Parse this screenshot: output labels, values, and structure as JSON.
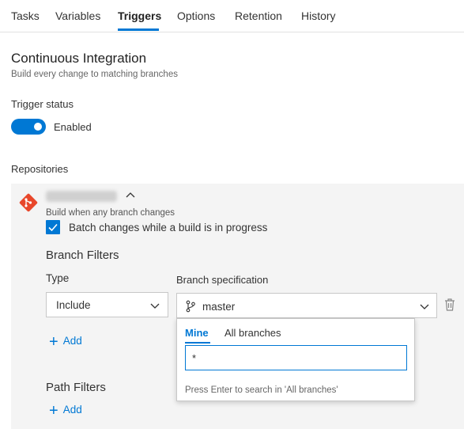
{
  "tabs": [
    {
      "label": "Tasks",
      "active": false
    },
    {
      "label": "Variables",
      "active": false
    },
    {
      "label": "Triggers",
      "active": true
    },
    {
      "label": "Options",
      "active": false
    },
    {
      "label": "Retention",
      "active": false
    },
    {
      "label": "History",
      "active": false
    }
  ],
  "ci": {
    "title": "Continuous Integration",
    "subtitle": "Build every change to matching branches"
  },
  "trigger_status": {
    "label": "Trigger status",
    "enabled": true,
    "state_label": "Enabled"
  },
  "repositories": {
    "label": "Repositories",
    "repo": {
      "icon": "git-icon",
      "name_obscured": true,
      "build_when": "Build when any branch changes",
      "batch_changes": {
        "checked": true,
        "label": "Batch changes while a build is in progress"
      }
    }
  },
  "branch_filters": {
    "label": "Branch Filters",
    "type_label": "Type",
    "spec_label": "Branch specification",
    "type_value": "Include",
    "branch_value": "master",
    "add_label": "Add"
  },
  "branch_dropdown": {
    "tabs": [
      {
        "label": "Mine",
        "active": true
      },
      {
        "label": "All branches",
        "active": false
      }
    ],
    "search_value": "*",
    "hint": "Press Enter to search in 'All branches'"
  },
  "path_filters": {
    "label": "Path Filters",
    "add_label": "Add"
  },
  "colors": {
    "accent": "#0078d4",
    "git_brand": "#e8472b",
    "panel_bg": "#f4f4f4"
  }
}
